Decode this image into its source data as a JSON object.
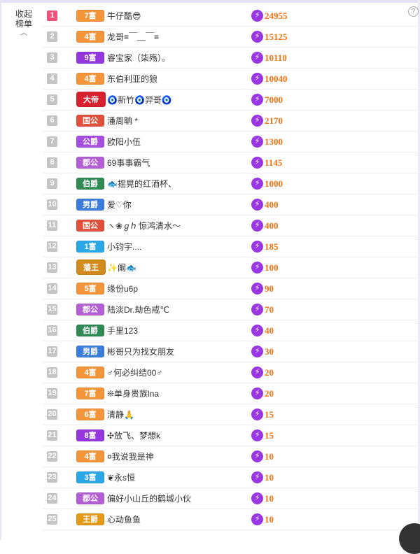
{
  "collapse_label_line1": "收起",
  "collapse_label_line2": "榜单",
  "help_symbol": "?",
  "score_icon_glyph": "⚡",
  "colors": {
    "rank_top": "#f0517a",
    "rank_default": "#c4c4c4",
    "score_text": "#f37212",
    "score_icon": "#9a37e2"
  },
  "rows": [
    {
      "rank": "1",
      "badge": "7富",
      "badge_color": "#f5953a",
      "name": "牛仔酷😎",
      "score": "24955"
    },
    {
      "rank": "2",
      "badge": "4富",
      "badge_color": "#f5953a",
      "name": "龙哥≡￣﹏￣≡",
      "score": "15125"
    },
    {
      "rank": "3",
      "badge": "9富",
      "badge_color": "#9536e0",
      "name": "睿宝家（柒殇）。",
      "score": "10110"
    },
    {
      "rank": "4",
      "badge": "4富",
      "badge_color": "#f5953a",
      "name": "东伯利亚的狼",
      "score": "10040"
    },
    {
      "rank": "5",
      "badge": "大帝",
      "badge_color": "#d8212e",
      "name": "🧿新竹🧿羿哥🧿",
      "score": "7000"
    },
    {
      "rank": "6",
      "badge": "国公",
      "badge_color": "#e24f3d",
      "name": "潘周聃 *",
      "score": "2170"
    },
    {
      "rank": "7",
      "badge": "公爵",
      "badge_color": "#a64fe2",
      "name": "欧阳小伍",
      "score": "1300"
    },
    {
      "rank": "8",
      "badge": "郡公",
      "badge_color": "#b45fd6",
      "name": "69事事霸气",
      "score": "1145"
    },
    {
      "rank": "9",
      "badge": "伯爵",
      "badge_color": "#2f8a54",
      "name": "🐟摇晃的红酒杯、",
      "score": "1000"
    },
    {
      "rank": "10",
      "badge": "男爵",
      "badge_color": "#3c7ddc",
      "name": "爱♡你",
      "score": "400"
    },
    {
      "rank": "11",
      "badge": "国公",
      "badge_color": "#e24f3d",
      "name": "ヽ❀ℊℎ 惊鸿清水～",
      "score": "400"
    },
    {
      "rank": "12",
      "badge": "1富",
      "badge_color": "#29a8e8",
      "name": "小钧宇....",
      "score": "185"
    },
    {
      "rank": "13",
      "badge": "藩王",
      "badge_color": "#d28a1e",
      "name": "✨阚🐟",
      "score": "100"
    },
    {
      "rank": "14",
      "badge": "5富",
      "badge_color": "#f5953a",
      "name": "缘份u6p",
      "score": "90"
    },
    {
      "rank": "15",
      "badge": "郡公",
      "badge_color": "#b45fd6",
      "name": "陆淡Dr.劫色戒℃",
      "score": "70"
    },
    {
      "rank": "16",
      "badge": "伯爵",
      "badge_color": "#2f8a54",
      "name": "手里123",
      "score": "40"
    },
    {
      "rank": "17",
      "badge": "男爵",
      "badge_color": "#3c7ddc",
      "name": "彬哥只为找女朋友",
      "score": "30"
    },
    {
      "rank": "18",
      "badge": "4富",
      "badge_color": "#f5953a",
      "name": "♂何必纠结00♂",
      "score": "20"
    },
    {
      "rank": "19",
      "badge": "7富",
      "badge_color": "#f5953a",
      "name": "❊单身贵族lna",
      "score": "20"
    },
    {
      "rank": "20",
      "badge": "6富",
      "badge_color": "#f5953a",
      "name": "清静🙏",
      "score": "15"
    },
    {
      "rank": "21",
      "badge": "8富",
      "badge_color": "#9536e0",
      "name": "✣放飞、梦想k",
      "score": "15"
    },
    {
      "rank": "22",
      "badge": "4富",
      "badge_color": "#f5953a",
      "name": "¤我说我是神",
      "score": "10"
    },
    {
      "rank": "23",
      "badge": "3富",
      "badge_color": "#29a8e8",
      "name": "❦永s恒",
      "score": "10"
    },
    {
      "rank": "24",
      "badge": "郡公",
      "badge_color": "#b45fd6",
      "name": "偏好小山丘的鹤城小伙",
      "score": "10"
    },
    {
      "rank": "25",
      "badge": "王爵",
      "badge_color": "#e59a17",
      "name": "心动鱼鱼",
      "score": "10"
    }
  ]
}
